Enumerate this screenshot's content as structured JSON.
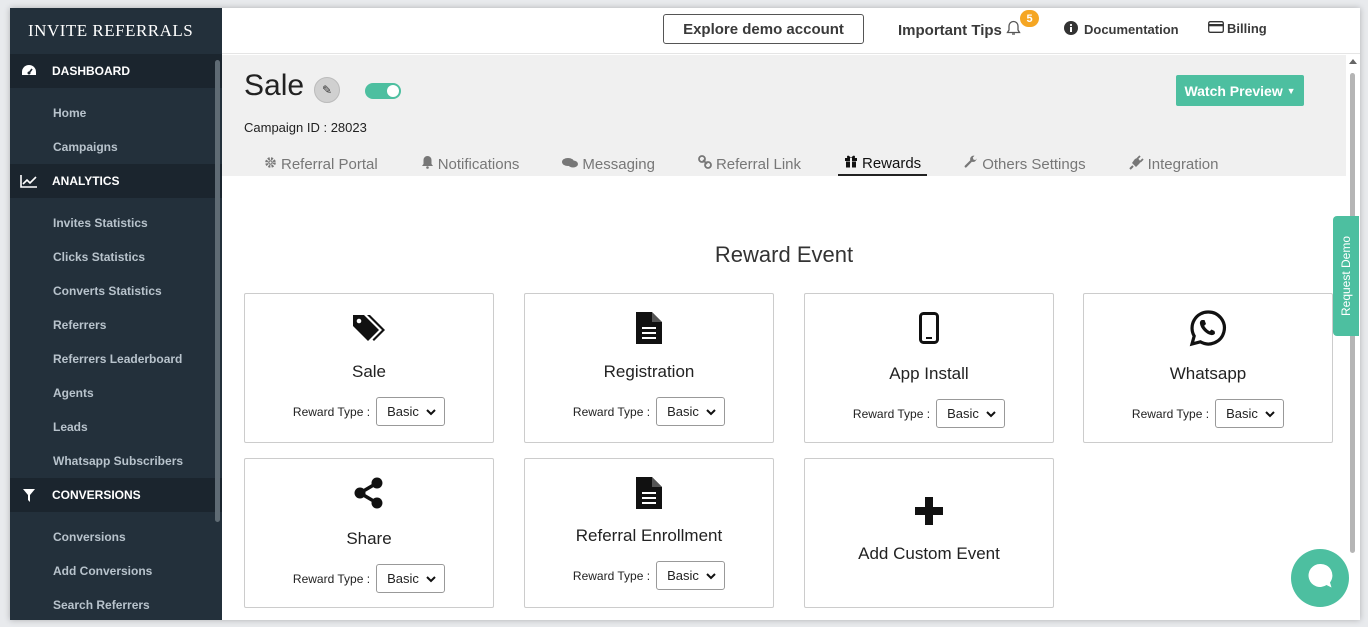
{
  "app": {
    "logo_text": "INVITE REFERRALS"
  },
  "sidebar": {
    "sections": [
      {
        "label": "DASHBOARD",
        "icon": "dashboard-icon",
        "items": [
          "Home",
          "Campaigns"
        ]
      },
      {
        "label": "ANALYTICS",
        "icon": "chart-line-icon",
        "items": [
          "Invites Statistics",
          "Clicks Statistics",
          "Converts Statistics",
          "Referrers",
          "Referrers Leaderboard",
          "Agents",
          "Leads",
          "Whatsapp Subscribers"
        ]
      },
      {
        "label": "CONVERSIONS",
        "icon": "filter-icon",
        "items": [
          "Conversions",
          "Add Conversions",
          "Search Referrers"
        ]
      }
    ]
  },
  "topbar": {
    "explore_label": "Explore demo account",
    "tips_label": "Important Tips",
    "tips_count": "5",
    "documentation_label": "Documentation",
    "billing_label": "Billing"
  },
  "campaign": {
    "title": "Sale",
    "campaign_id_text": "Campaign ID : 28023",
    "watch_preview_label": "Watch Preview",
    "active": true
  },
  "tabs": [
    {
      "label": "Referral Portal",
      "icon": "gear-icon"
    },
    {
      "label": "Notifications",
      "icon": "bell-icon"
    },
    {
      "label": "Messaging",
      "icon": "comments-icon"
    },
    {
      "label": "Referral Link",
      "icon": "link-icon"
    },
    {
      "label": "Rewards",
      "icon": "gift-icon",
      "active": true
    },
    {
      "label": "Others Settings",
      "icon": "wrench-icon"
    },
    {
      "label": "Integration",
      "icon": "plug-icon"
    }
  ],
  "rewards": {
    "section_title": "Reward Event",
    "reward_type_label": "Reward Type :",
    "events": [
      {
        "name": "Sale",
        "icon": "tags-icon",
        "reward_type": "Basic"
      },
      {
        "name": "Registration",
        "icon": "file-icon",
        "reward_type": "Basic"
      },
      {
        "name": "App Install",
        "icon": "mobile-icon",
        "reward_type": "Basic"
      },
      {
        "name": "Whatsapp",
        "icon": "whatsapp-icon",
        "reward_type": "Basic"
      },
      {
        "name": "Share",
        "icon": "share-icon",
        "reward_type": "Basic"
      },
      {
        "name": "Referral Enrollment",
        "icon": "file-icon",
        "reward_type": "Basic"
      }
    ],
    "add_custom_label": "Add Custom Event"
  },
  "side_widgets": {
    "request_demo_label": "Request Demo"
  },
  "colors": {
    "accent": "#4dbfa0",
    "sidebar_bg": "#23303b",
    "badge": "#f5a623"
  }
}
